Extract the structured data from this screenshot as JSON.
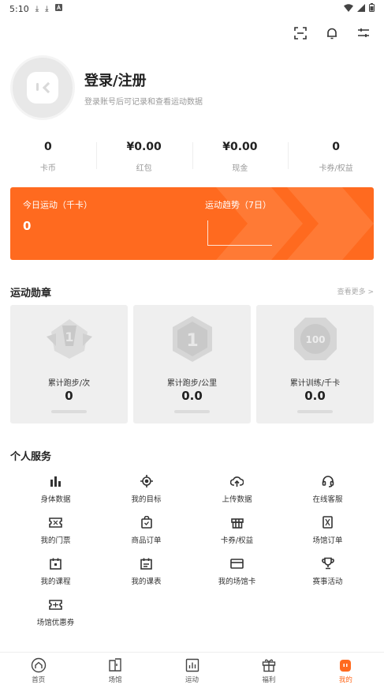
{
  "status_bar": {
    "time": "5:10"
  },
  "profile": {
    "title": "登录/注册",
    "subtitle": "登录账号后可记录和查看运动数据"
  },
  "stats": [
    {
      "value": "0",
      "label": "卡币"
    },
    {
      "value": "¥0.00",
      "label": "红包"
    },
    {
      "value": "¥0.00",
      "label": "现金"
    },
    {
      "value": "0",
      "label": "卡券/权益"
    }
  ],
  "sport_card": {
    "today_label": "今日运动（千卡）",
    "today_value": "0",
    "trend_label": "运动趋势（7日）",
    "color": "#ff6a1f"
  },
  "badges_section": {
    "title": "运动勋章",
    "see_more": "查看更多 >",
    "items": [
      {
        "label": "累计跑步/次",
        "value": "0",
        "icon": "running-count-medal"
      },
      {
        "label": "累计跑步/公里",
        "value": "0.0",
        "icon": "running-distance-medal"
      },
      {
        "label": "累计训练/千卡",
        "value": "0.0",
        "icon": "training-calorie-medal"
      }
    ]
  },
  "services_section": {
    "title": "个人服务",
    "items": [
      {
        "label": "身体数据",
        "icon": "bar-chart-icon"
      },
      {
        "label": "我的目标",
        "icon": "target-icon"
      },
      {
        "label": "上传数据",
        "icon": "upload-cloud-icon"
      },
      {
        "label": "在线客服",
        "icon": "headset-icon"
      },
      {
        "label": "我的门票",
        "icon": "ticket-icon"
      },
      {
        "label": "商品订单",
        "icon": "shopping-bag-icon"
      },
      {
        "label": "卡券/权益",
        "icon": "gift-icon"
      },
      {
        "label": "场馆订单",
        "icon": "venue-order-icon"
      },
      {
        "label": "我的课程",
        "icon": "calendar-icon"
      },
      {
        "label": "我的课表",
        "icon": "schedule-icon"
      },
      {
        "label": "我的场馆卡",
        "icon": "card-icon"
      },
      {
        "label": "赛事活动",
        "icon": "trophy-icon"
      },
      {
        "label": "场馆优惠券",
        "icon": "coupon-icon"
      }
    ]
  },
  "tabbar": {
    "items": [
      {
        "label": "首页",
        "icon": "home-icon"
      },
      {
        "label": "场馆",
        "icon": "venue-icon"
      },
      {
        "label": "运动",
        "icon": "sport-icon"
      },
      {
        "label": "福利",
        "icon": "gift-box-icon"
      },
      {
        "label": "我的",
        "icon": "profile-icon"
      }
    ],
    "active": "我的",
    "active_color": "#ff6a1f"
  }
}
